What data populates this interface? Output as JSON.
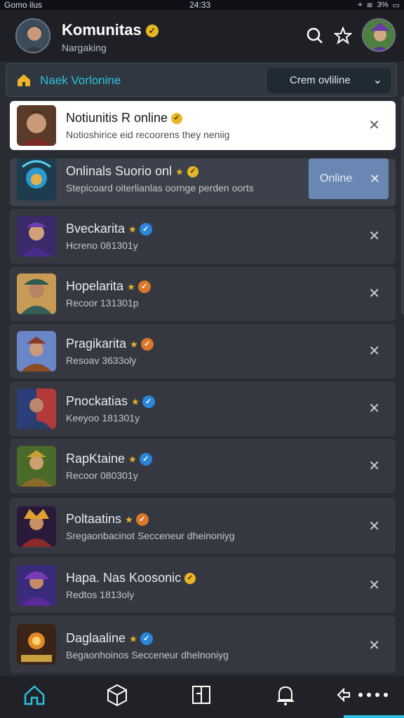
{
  "status": {
    "left": "Gomo ilus",
    "time": "24:33",
    "right": "3%"
  },
  "header": {
    "title": "Komunitas",
    "subtitle": "Nargaking",
    "badge": "✓"
  },
  "filter": {
    "label": "Naek Vorlonine",
    "select_value": "Crem ovliline"
  },
  "cards": [
    {
      "name": "Notiunitis R online",
      "sub": "Notioshirice eid recoorens they neniig",
      "style": "white",
      "badge": "gold"
    },
    {
      "name": "Onlinals Suorio onl",
      "sub": "Stepicoard oiterlianlas oornge perden oorts",
      "style": "selected",
      "badge": "gold",
      "online_label": "Online"
    },
    {
      "name": "Bveckarita",
      "sub": "Hcreno 081301y",
      "style": "dark",
      "badge": "blue"
    },
    {
      "name": "Hopelarita",
      "sub": "Recoor 131301p",
      "style": "dark",
      "badge": "orange"
    },
    {
      "name": "Pragikarita",
      "sub": "Resoav 3633oly",
      "style": "dark",
      "badge": "orange"
    },
    {
      "name": "Pnockatias",
      "sub": "Keeyoo 181301y",
      "style": "dark",
      "badge": "blue"
    },
    {
      "name": "RapKtaine",
      "sub": "Recoor 080301y",
      "style": "dark",
      "badge": "blue"
    },
    {
      "name": "Poltaatins",
      "sub": "Sregaonbacinot Secceneur dheinoniyg",
      "style": "dark",
      "badge": "orange"
    },
    {
      "name": "Hapa. Nas Koosonic",
      "sub": "Redtos 1813oly",
      "style": "dark",
      "badge": "gold"
    },
    {
      "name": "Daglaaline",
      "sub": "Begaonhoinos Secceneur dhelnoniyg",
      "style": "dark",
      "badge": "blue"
    }
  ],
  "colors": {
    "accent": "#2fc0df",
    "online": "#6a86b2",
    "gold": "#e8b625"
  }
}
